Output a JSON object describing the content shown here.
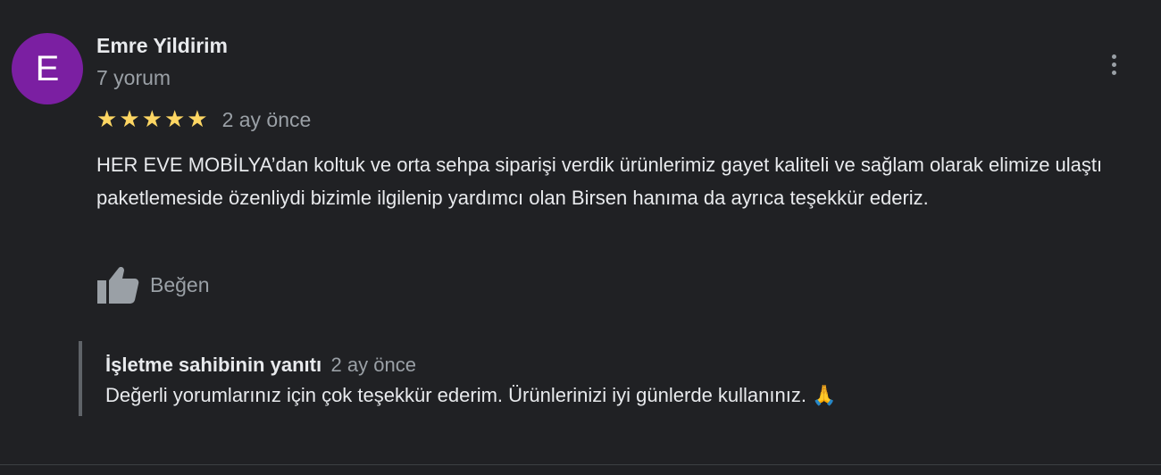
{
  "review": {
    "avatar_letter": "E",
    "author_name": "Emre Yildirim",
    "review_count": "7 yorum",
    "rating": 5,
    "rating_max": 5,
    "date": "2 ay önce",
    "text": "HER EVE MOBİLYA’dan koltuk ve orta sehpa siparişi verdik ürünlerimiz gayet kaliteli ve sağlam olarak elimize ulaştı paketlemeside özenliydi bizimle ilgilenip yardımcı olan Birsen hanıma da ayrıca teşekkür ederiz.",
    "like_label": "Beğen",
    "more_icon": "more-vert-icon",
    "like_icon": "thumb-up-icon"
  },
  "owner_reply": {
    "title": "İşletme sahibinin yanıtı",
    "date": "2 ay önce",
    "text": "Değerli yorumlarınız için çok teşekkür ederim. Ürünlerinizi iyi günlerde kullanınız.",
    "emoji": "🙏"
  },
  "colors": {
    "background": "#202124",
    "avatar": "#7b1fa2",
    "star": "#fdd663",
    "primary_text": "#e8eaed",
    "secondary_text": "#9aa0a6"
  }
}
